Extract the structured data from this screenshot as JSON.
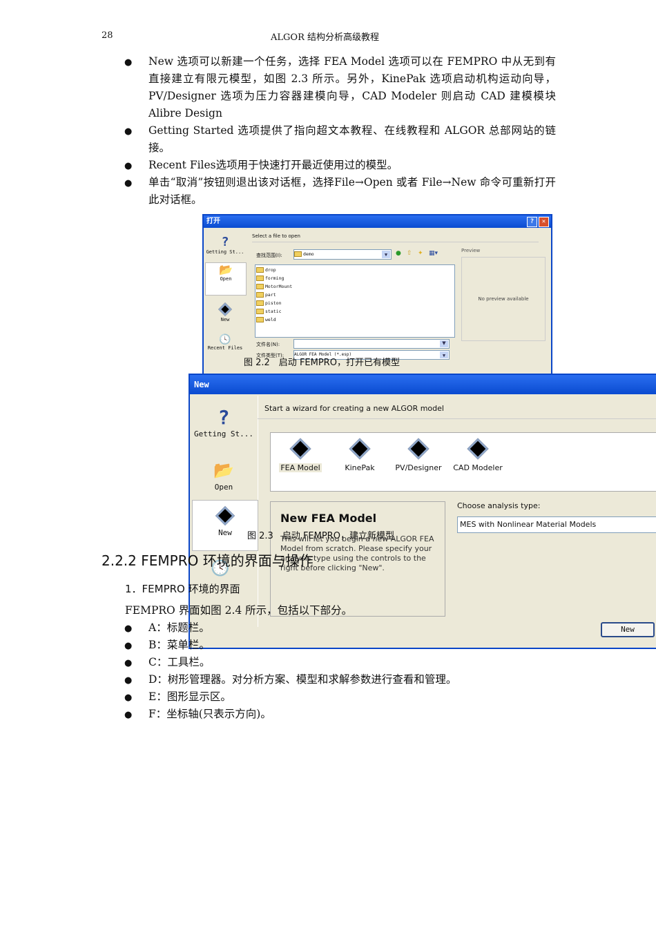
{
  "header": {
    "page_number": "28",
    "book_title": "ALGOR 结构分析高级教程"
  },
  "bullets_top": [
    "New 选项可以新建一个任务，选择 FEA Model 选项可以在 FEMPRO 中从无到有直接建立有限元模型，如图 2.3 所示。另外，KinePak 选项启动机构运动向导，PV/Designer 选项为压力容器建模向导，CAD Modeler 则启动 CAD 建模模块 Alibre Design",
    "Getting Started 选项提供了指向超文本教程、在线教程和 ALGOR 总部网站的链接。",
    "Recent Files选项用于快速打开最近使用过的模型。",
    "单击“取消”按钮则退出该对话框，选择File→Open 或者 File→New 命令可重新打开此对话框。"
  ],
  "open_dialog": {
    "title": "打开",
    "sidebar": [
      "Getting St...",
      "Open",
      "New",
      "Recent Files"
    ],
    "instruction": "Select a file to open",
    "look_in_label": "查找范围(I):",
    "look_in_value": "demo",
    "folders": [
      "drop",
      "forming",
      "MotorMount",
      "part",
      "piston",
      "static",
      "weld"
    ],
    "filename_label": "文件名(N):",
    "filename_value": "",
    "filetype_label": "文件类型(T):",
    "filetype_value": "ALGOR FEA Model (*.esp)",
    "preview_label": "Preview",
    "preview_text": "No preview available"
  },
  "fig22_caption": "图 2.2　启动 FEMPRO，打开已有模型",
  "new_dialog": {
    "title": "New",
    "sidebar": [
      "Getting St...",
      "Open",
      "New"
    ],
    "instruction": "Start a wizard for creating a new ALGOR model",
    "wizards": [
      "FEA Model",
      "KinePak",
      "PV/Designer",
      "CAD Modeler"
    ],
    "desc_title": "New FEA Model",
    "desc_text": "This will let you begin a new ALGOR FEA Model from scratch.  Please specify your analysis type using the controls to the right before clicking \"New\".",
    "analysis_label": "Choose analysis type:",
    "analysis_value": "MES with Nonlinear Material Models",
    "new_button": "New"
  },
  "fig23_caption": "图 2.3　启动 FEMPRO，建立新模型",
  "section_heading": "2.2.2  FEMPRO  环境的界面与操作",
  "subsection_heading": "1．FEMPRO 环境的界面",
  "intro": "FEMPRO 界面如图 2.4 所示，包括以下部分。",
  "parts": [
    "A：标题栏。",
    "B：菜单栏。",
    "C：工具栏。",
    "D：树形管理器。对分析方案、模型和求解参数进行查看和管理。",
    "E：图形显示区。",
    "F：坐标轴(只表示方向)。"
  ]
}
